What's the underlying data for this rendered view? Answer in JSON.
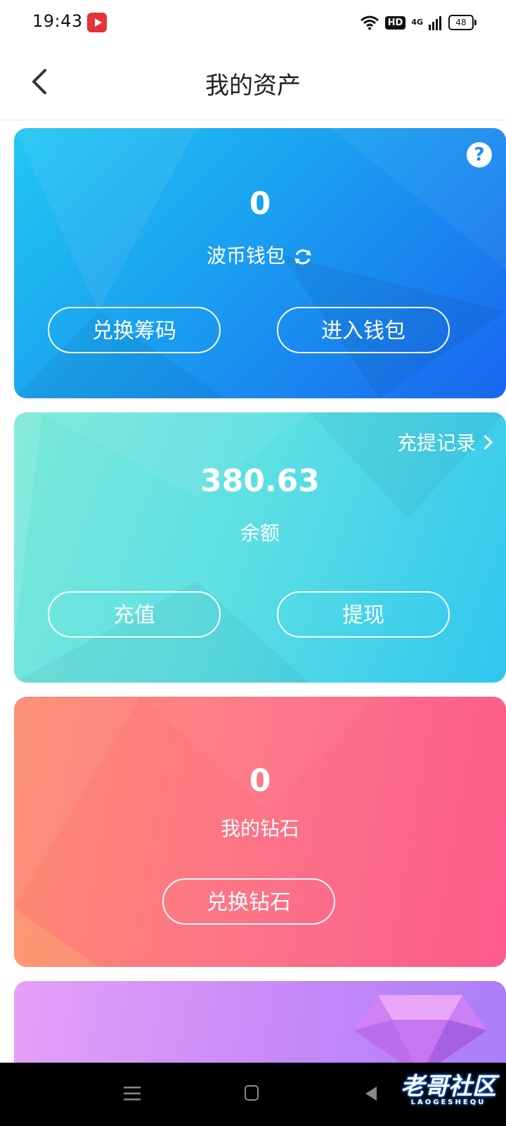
{
  "status_bar": {
    "time": "19:43",
    "hd": "HD",
    "network": "4G",
    "battery": "48"
  },
  "header": {
    "title": "我的资产",
    "back_icon": "chevron-left-icon"
  },
  "wallet_card": {
    "amount": "0",
    "label": "波币钱包",
    "help_icon": "?",
    "buttons": {
      "exchange_chips": "兑换筹码",
      "enter_wallet": "进入钱包"
    },
    "colors": [
      "#22c7f2",
      "#1966ef"
    ]
  },
  "balance_card": {
    "records_link": "充提记录",
    "amount": "380.63",
    "label": "余额",
    "buttons": {
      "recharge": "充值",
      "withdraw": "提现"
    },
    "colors": [
      "#7be9d9",
      "#2fc6ef"
    ]
  },
  "diamond_card": {
    "amount": "0",
    "label": "我的钻石",
    "buttons": {
      "exchange_diamonds": "兑换钻石"
    },
    "colors": [
      "#fc8a6e",
      "#fd5a8c"
    ]
  },
  "fourth_card": {
    "colors": [
      "#e6a0f7",
      "#a97ef6"
    ],
    "icon": "gem-icon"
  },
  "watermark": {
    "text": "老哥社区",
    "sub": "LAOGESHEQU"
  }
}
